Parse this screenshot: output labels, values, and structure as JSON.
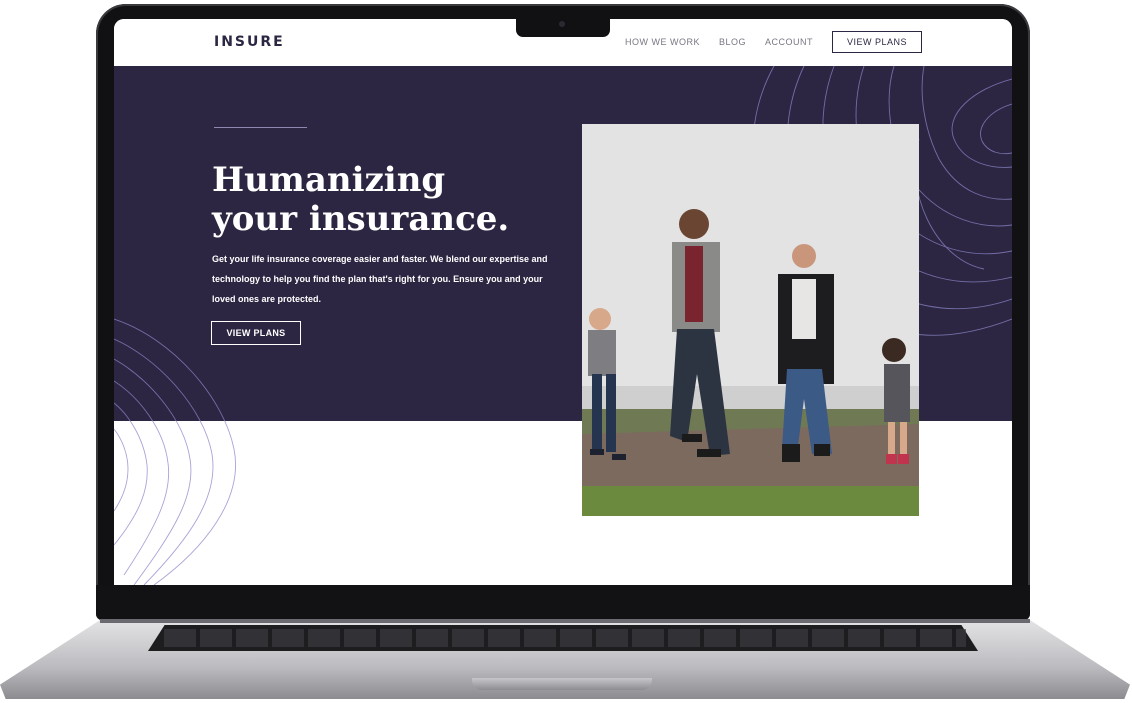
{
  "site": {
    "logo": "INSURE",
    "nav": {
      "items": [
        "HOW WE WORK",
        "BLOG",
        "ACCOUNT"
      ],
      "cta": "VIEW PLANS"
    },
    "hero": {
      "title_line1": "Humanizing",
      "title_line2": "your insurance.",
      "description": "Get your life insurance coverage easier and faster. We blend our expertise and technology to help you find the plan that's right for you. Ensure you and your loved ones are protected.",
      "button": "VIEW PLANS"
    },
    "image": {
      "subject": "family-walking-photo"
    }
  },
  "colors": {
    "hero_bg": "#2d2642",
    "logo": "#2c2642",
    "nav_text": "#777783",
    "contour_line": "#8b86c9"
  }
}
